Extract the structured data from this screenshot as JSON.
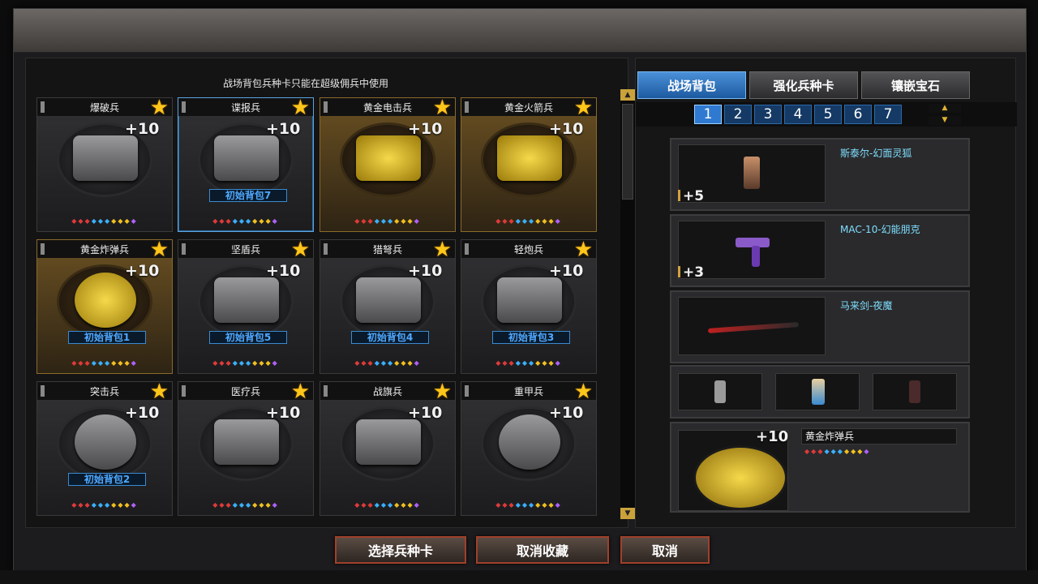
{
  "dialog": {
    "notice": "战场背包兵种卡只能在超级佣兵中使用"
  },
  "cards": [
    {
      "name": "爆破兵",
      "level": "+10",
      "badge": "",
      "gold": false,
      "selected": false,
      "icon": "bomb-icon"
    },
    {
      "name": "谍报兵",
      "level": "+10",
      "badge": "初始背包7",
      "gold": false,
      "selected": true,
      "icon": "mask-icon"
    },
    {
      "name": "黄金电击兵",
      "level": "+10",
      "badge": "",
      "gold": true,
      "selected": false,
      "icon": "gold-glove-icon"
    },
    {
      "name": "黄金火箭兵",
      "level": "+10",
      "badge": "",
      "gold": true,
      "selected": false,
      "icon": "gold-rocket-icon"
    },
    {
      "name": "黄金炸弹兵",
      "level": "+10",
      "badge": "初始背包1",
      "gold": true,
      "selected": false,
      "icon": "gold-bomb-icon"
    },
    {
      "name": "坚盾兵",
      "level": "+10",
      "badge": "初始背包5",
      "gold": false,
      "selected": false,
      "icon": "shield-icon"
    },
    {
      "name": "猎弩兵",
      "level": "+10",
      "badge": "初始背包4",
      "gold": false,
      "selected": false,
      "icon": "crossbow-icon"
    },
    {
      "name": "轻炮兵",
      "level": "+10",
      "badge": "初始背包3",
      "gold": false,
      "selected": false,
      "icon": "mortar-icon"
    },
    {
      "name": "突击兵",
      "level": "+10",
      "badge": "初始背包2",
      "gold": false,
      "selected": false,
      "icon": "assault-icon"
    },
    {
      "name": "医疗兵",
      "level": "+10",
      "badge": "",
      "gold": false,
      "selected": false,
      "icon": "medkit-icon"
    },
    {
      "name": "战旗兵",
      "level": "+10",
      "badge": "",
      "gold": false,
      "selected": false,
      "icon": "banner-icon"
    },
    {
      "name": "重甲兵",
      "level": "+10",
      "badge": "",
      "gold": false,
      "selected": false,
      "icon": "armor-icon"
    }
  ],
  "gems_pattern": [
    "r",
    "r",
    "r",
    "b",
    "b",
    "b",
    "y",
    "y",
    "y",
    "p"
  ],
  "gem_colors": {
    "r": "#e03a3a",
    "b": "#3ab0ff",
    "y": "#f0c020",
    "p": "#b060ff"
  },
  "tabs": [
    {
      "label": "战场背包",
      "active": true
    },
    {
      "label": "强化兵种卡",
      "active": false
    },
    {
      "label": "镶嵌宝石",
      "active": false
    }
  ],
  "pages": [
    "1",
    "2",
    "3",
    "4",
    "5",
    "6",
    "7"
  ],
  "active_page": "1",
  "slots": [
    {
      "name": "斯泰尔-幻面灵狐",
      "ammo": "+5",
      "icon": "character-icon"
    },
    {
      "name": "MAC-10-幻能朋克",
      "ammo": "+3",
      "icon": "smg-icon"
    },
    {
      "name": "马来剑-夜魔",
      "ammo": "",
      "icon": "sword-icon"
    }
  ],
  "small_items": [
    "grenade-icon",
    "doll-icon",
    "device-icon"
  ],
  "selected_card": {
    "name": "黄金炸弹兵",
    "level": "+10"
  },
  "buttons": {
    "select": "选择兵种卡",
    "unfavorite": "取消收藏",
    "cancel": "取消"
  }
}
